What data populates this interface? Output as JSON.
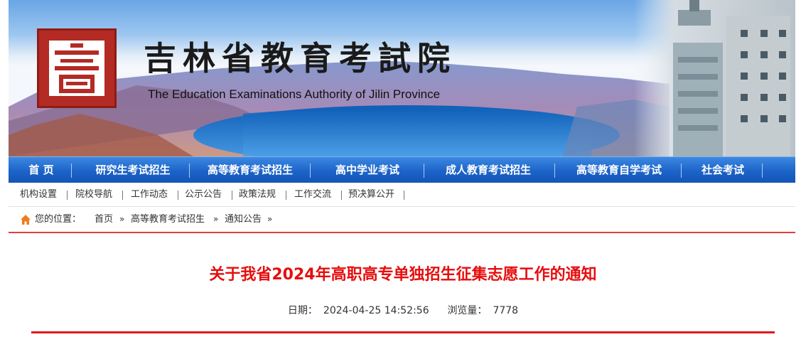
{
  "banner": {
    "title": "吉林省教育考試院",
    "subtitle": "The Education Examinations Authority of Jilin Province",
    "colors": {
      "logo_red": "#b32b24",
      "sky": "#6aa6e6",
      "lake": "#1f6fc0"
    }
  },
  "main_nav": {
    "items": [
      {
        "label": "首 页"
      },
      {
        "label": "研究生考试招生"
      },
      {
        "label": "高等教育考试招生"
      },
      {
        "label": "高中学业考试"
      },
      {
        "label": "成人教育考试招生"
      },
      {
        "label": "高等教育自学考试"
      },
      {
        "label": "社会考试"
      }
    ],
    "color": "#1c63c8"
  },
  "sub_nav": {
    "items": [
      {
        "label": "机构设置"
      },
      {
        "label": "院校导航"
      },
      {
        "label": "工作动态"
      },
      {
        "label": "公示公告"
      },
      {
        "label": "政策法规"
      },
      {
        "label": "工作交流"
      },
      {
        "label": "预决算公开"
      }
    ]
  },
  "breadcrumb": {
    "prefix": "您的位置：",
    "items": [
      {
        "label": "首页"
      },
      {
        "label": "高等教育考试招生"
      },
      {
        "label": "通知公告"
      }
    ],
    "separator": "»",
    "icon": "home-icon"
  },
  "article": {
    "title": "关于我省2024年高职高专单独招生征集志愿工作的通知",
    "date_label": "日期：",
    "date": "2024-04-25 14:52:56",
    "views_label": "浏览量：",
    "views": "7778",
    "accent": "#e60d0d"
  }
}
